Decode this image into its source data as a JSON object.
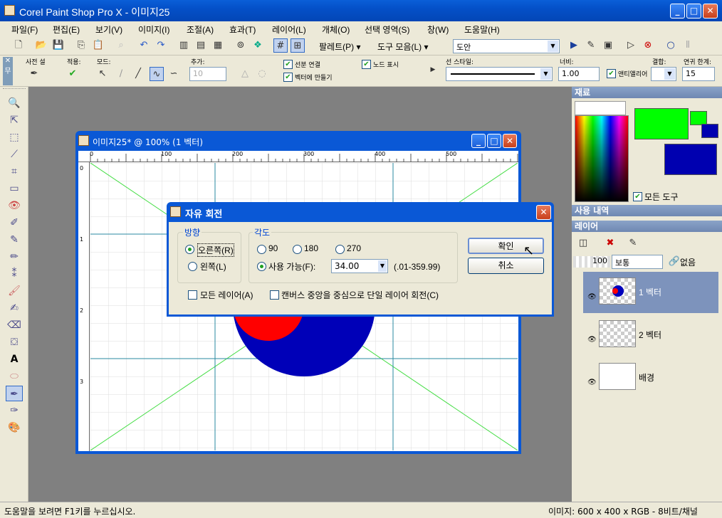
{
  "app": {
    "title": "Corel Paint Shop Pro X - 이미지25"
  },
  "menu": [
    "파일(F)",
    "편집(E)",
    "보기(V)",
    "이미지(I)",
    "조절(A)",
    "효과(T)",
    "레이어(L)",
    "개체(O)",
    "선택 영역(S)",
    "창(W)",
    "도움말(H)"
  ],
  "toolbar1": {
    "palette": "팔레트(P) ▾",
    "tools": "도구 모음(L) ▾",
    "font": "도안"
  },
  "toolbar2": {
    "presets": "사전 설",
    "mode_label": "적용:",
    "modes": "모드:",
    "add": "추가:",
    "add_value": "10",
    "chk_connect": "선분 연결",
    "chk_node": "노드 표시",
    "chk_vector": "벡터에 만들기",
    "line_style": "선 스타일:",
    "width_label": "너비:",
    "width_value": "1.00",
    "antialias": "앤티앨리어",
    "join_label": "결합:",
    "miter_label": "연귀 한계:",
    "miter_value": "15"
  },
  "document": {
    "title": "이미지25* @ 100% (1 벡터)",
    "ruler_marks": [
      "0",
      "100",
      "200",
      "300",
      "400",
      "500"
    ],
    "vruler_marks": [
      "0",
      "1",
      "2",
      "3"
    ]
  },
  "dialog": {
    "title": "자유 회전",
    "direction_label": "방향",
    "right": "오른쪽(R)",
    "left": "왼쪽(L)",
    "angle_label": "각도",
    "a90": "90",
    "a180": "180",
    "a270": "270",
    "free": "사용 가능(F):",
    "free_value": "34.00",
    "range": "(.01-359.99)",
    "all_layers": "모든 레이어(A)",
    "single_layer": "캔버스 중앙을 중심으로 단일 레이어 회전(C)",
    "ok": "확인",
    "cancel": "취소"
  },
  "panels": {
    "materials": "재료",
    "all_tools": "모든 도구",
    "history": "사용 내역",
    "layers": "레이어",
    "opacity": "100",
    "blend": "보통",
    "none": "없음",
    "layer_list": [
      "1 벡터",
      "2 벡터",
      "배경"
    ],
    "fg_color": "#00ff00",
    "bg_color": "#0000b0"
  },
  "status": {
    "left": "도움말을 보려면 F1키를 누르십시오.",
    "right": "이미지:  600 x 400 x RGB - 8비트/채널"
  }
}
